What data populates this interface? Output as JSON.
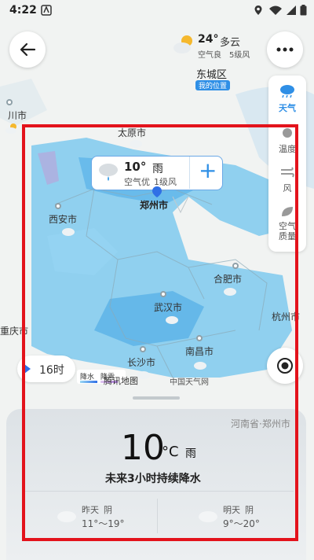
{
  "status": {
    "time": "4:22"
  },
  "top_weather": {
    "temp": "24°",
    "condition": "多云",
    "air": "空气良",
    "wind": "5级风"
  },
  "location": {
    "district": "东城区",
    "my_location": "我的位置"
  },
  "cities": [
    {
      "name": "川市",
      "key": "chuan"
    },
    {
      "name": "太原市",
      "key": "taiyuan"
    },
    {
      "name": "郑州市",
      "key": "zhengzhou"
    },
    {
      "name": "西安市",
      "key": "xian"
    },
    {
      "name": "合肥市",
      "key": "hefei"
    },
    {
      "name": "武汉市",
      "key": "wuhan"
    },
    {
      "name": "杭州市",
      "key": "hangzhou"
    },
    {
      "name": "重庆市",
      "key": "chongqing"
    },
    {
      "name": "长沙市",
      "key": "changsha"
    },
    {
      "name": "南昌市",
      "key": "nanchang"
    }
  ],
  "popup": {
    "temp": "10°",
    "condition": "雨",
    "air": "空气优",
    "wind": "1级风",
    "add_symbol": "+"
  },
  "side_panel": {
    "items": [
      "天气",
      "温度",
      "风",
      "空气质量"
    ]
  },
  "timeline": {
    "time": "16时"
  },
  "legend": {
    "rain": "降水",
    "snow": "降雪"
  },
  "attribution": {
    "map": "腾讯地图",
    "weather": "中国天气网"
  },
  "bottom": {
    "region": "河南省·郑州市",
    "temp": "10",
    "unit": "°C",
    "condition": "雨",
    "forecast": "未来3小时持续降水",
    "yesterday": {
      "label": "昨天",
      "condition": "阴",
      "range": "11°～19°"
    },
    "tomorrow": {
      "label": "明天",
      "condition": "阴",
      "range": "9°～20°"
    }
  },
  "colors": {
    "accent": "#2f8fe6",
    "rain": "#6fc3f0",
    "frame": "#e3131c"
  }
}
